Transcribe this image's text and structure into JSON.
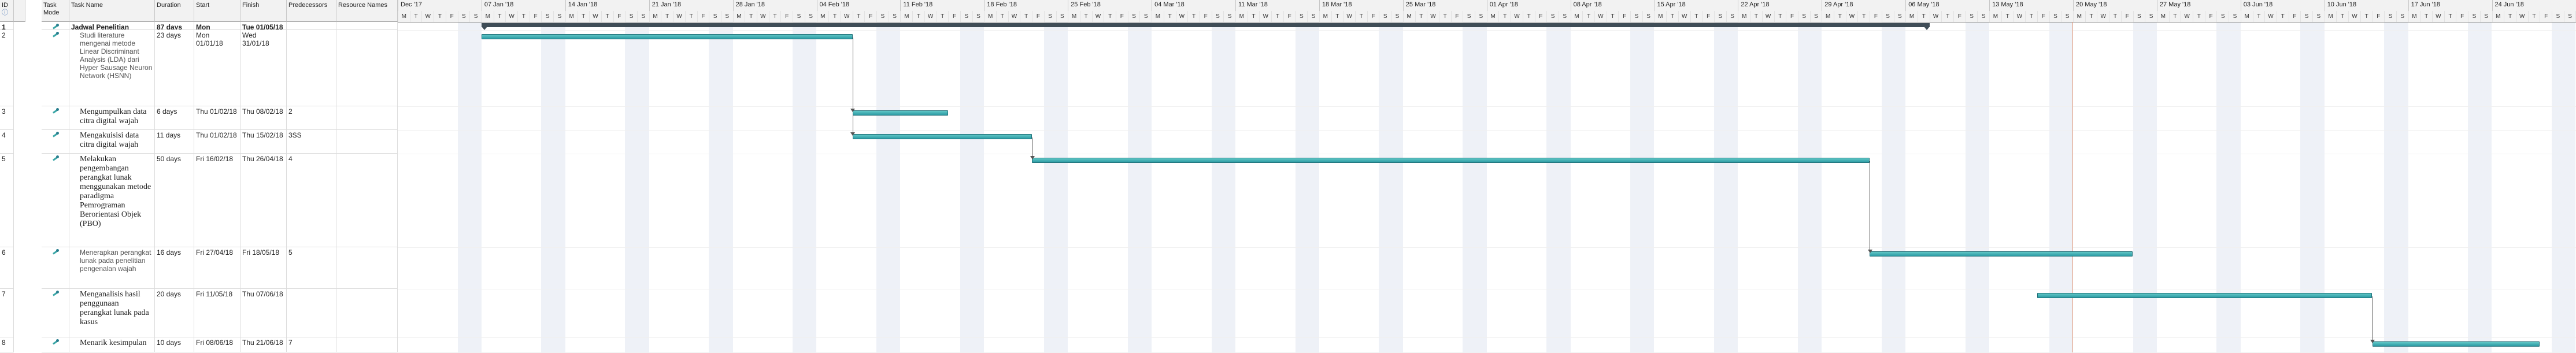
{
  "columns": {
    "id": "ID",
    "info": "ⓘ",
    "mode": "Task Mode",
    "name": "Task Name",
    "duration": "Duration",
    "start": "Start",
    "finish": "Finish",
    "predecessors": "Predecessors",
    "resources": "Resource Names"
  },
  "tasks": [
    {
      "id": "1",
      "name": "Jadwal Penelitian",
      "duration": "87 days",
      "start": "Mon 01/01/18",
      "finish": "Tue 01/05/18",
      "pred": "",
      "summary": true,
      "font": "sans"
    },
    {
      "id": "2",
      "name": "Studi literature mengenai metode Linear Discriminant Analysis (LDA) dari Hyper Sausage Neuron Network (HSNN)",
      "duration": "23 days",
      "start": "Mon 01/01/18",
      "finish": "Wed 31/01/18",
      "pred": "",
      "font": "sans"
    },
    {
      "id": "3",
      "name": "Mengumpulkan data citra digital wajah",
      "duration": "6 days",
      "start": "Thu 01/02/18",
      "finish": "Thu 08/02/18",
      "pred": "2",
      "font": "serif"
    },
    {
      "id": "4",
      "name": "Mengakuisisi data citra digital wajah",
      "duration": "11 days",
      "start": "Thu 01/02/18",
      "finish": "Thu 15/02/18",
      "pred": "3SS",
      "font": "serif"
    },
    {
      "id": "5",
      "name": "Melakukan pengembangan perangkat lunak menggunakan metode paradigma Pemrograman Berorientasi Objek (PBO)",
      "duration": "50 days",
      "start": "Fri 16/02/18",
      "finish": "Thu 26/04/18",
      "pred": "4",
      "font": "serif"
    },
    {
      "id": "6",
      "name": "Menerapkan perangkat lunak pada penelitian pengenalan wajah",
      "duration": "16 days",
      "start": "Fri 27/04/18",
      "finish": "Fri 18/05/18",
      "pred": "5",
      "font": "sans"
    },
    {
      "id": "7",
      "name": "Menganalisis hasil penggunaan perangkat lunak pada kasus",
      "duration": "20 days",
      "start": "Fri 11/05/18",
      "finish": "Thu 07/06/18",
      "pred": "",
      "font": "serif"
    },
    {
      "id": "8",
      "name": "Menarik kesimpulan",
      "duration": "10 days",
      "start": "Fri 08/06/18",
      "finish": "Thu 21/06/18",
      "pred": "7",
      "font": "serif"
    }
  ],
  "timescale": {
    "weeks": [
      "Dec '17",
      "07 Jan '18",
      "14 Jan '18",
      "21 Jan '18",
      "28 Jan '18",
      "04 Feb '18",
      "11 Feb '18",
      "18 Feb '18",
      "25 Feb '18",
      "04 Mar '18",
      "11 Mar '18",
      "18 Mar '18",
      "25 Mar '18",
      "01 Apr '18",
      "08 Apr '18",
      "15 Apr '18",
      "22 Apr '18",
      "29 Apr '18",
      "06 May '18",
      "13 May '18",
      "20 May '18",
      "27 May '18",
      "03 Jun '18",
      "10 Jun '18",
      "17 Jun '18",
      "24 Jun '18"
    ],
    "day_letters": [
      "M",
      "T",
      "W",
      "T",
      "F",
      "S",
      "S"
    ]
  },
  "colors": {
    "bar": "#2b9aa3",
    "summary": "#3f4d57",
    "weekend": "#eef1f7",
    "today": "#e39a7a"
  }
}
